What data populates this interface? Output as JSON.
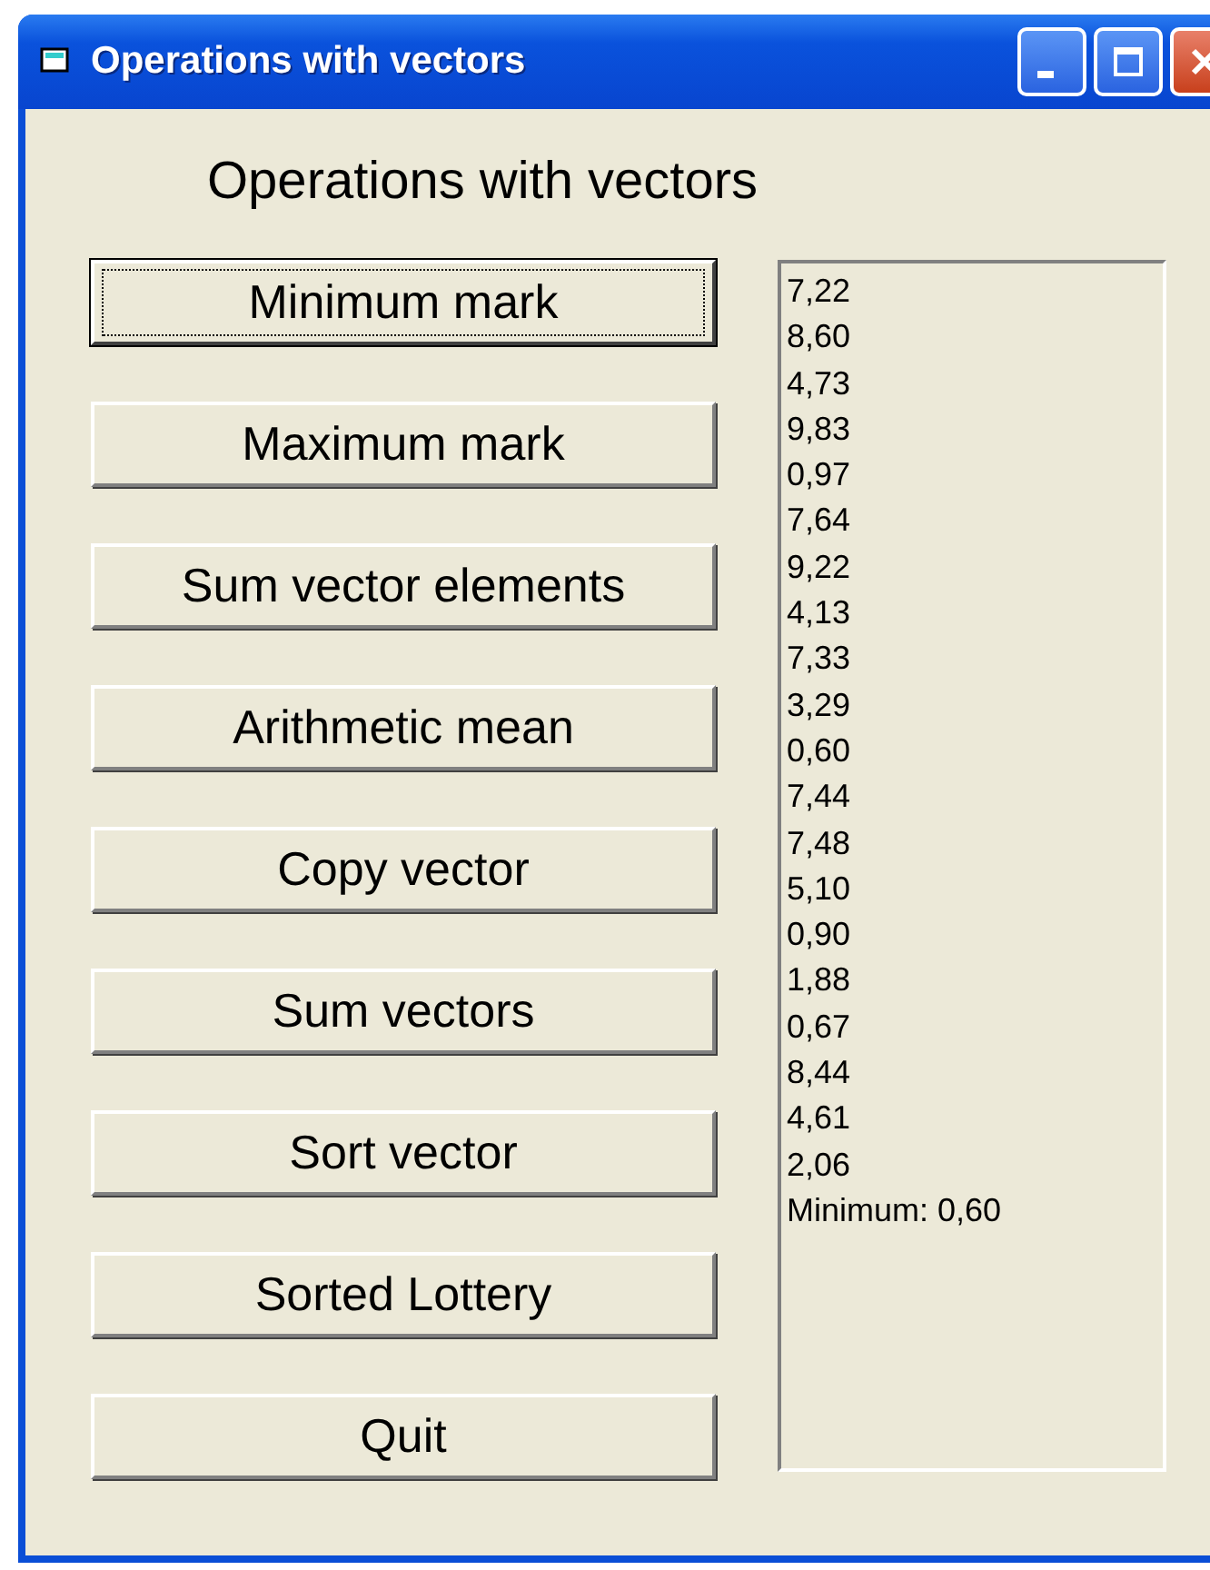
{
  "window": {
    "title": "Operations with vectors"
  },
  "heading": "Operations with vectors",
  "buttons": [
    {
      "label": "Minimum mark",
      "focused": true
    },
    {
      "label": "Maximum mark",
      "focused": false
    },
    {
      "label": "Sum vector elements",
      "focused": false
    },
    {
      "label": "Arithmetic mean",
      "focused": false
    },
    {
      "label": "Copy vector",
      "focused": false
    },
    {
      "label": "Sum vectors",
      "focused": false
    },
    {
      "label": "Sort vector",
      "focused": false
    },
    {
      "label": "Sorted Lottery",
      "focused": false
    },
    {
      "label": "Quit",
      "focused": false
    }
  ],
  "list": [
    "7,22",
    "8,60",
    "4,73",
    "9,83",
    "0,97",
    "7,64",
    "9,22",
    "4,13",
    "7,33",
    "3,29",
    "0,60",
    "7,44",
    "7,48",
    "5,10",
    "0,90",
    "1,88",
    "0,67",
    "8,44",
    "4,61",
    "2,06",
    "Minimum: 0,60"
  ]
}
